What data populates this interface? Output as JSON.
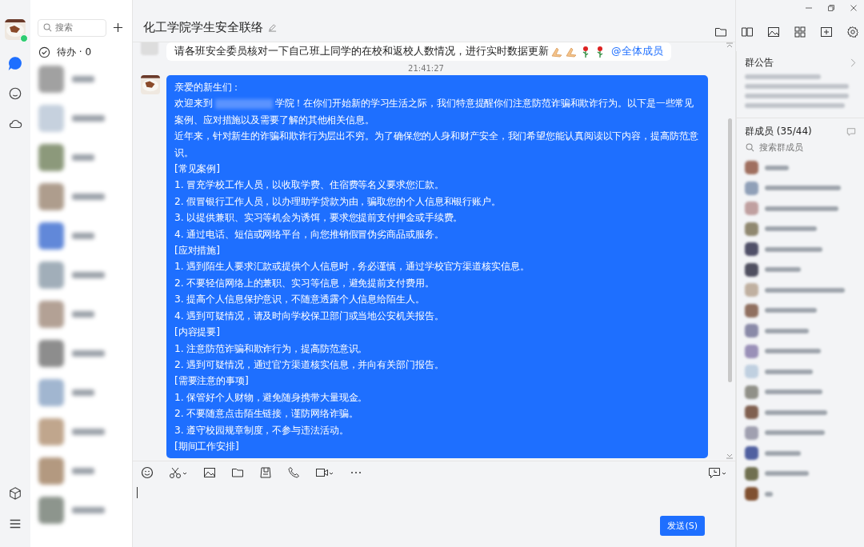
{
  "window": {
    "title": "化工学院学生安全联络"
  },
  "sidebar": {
    "nav": [
      {
        "kind": "chat",
        "selected": true
      },
      {
        "kind": "contacts",
        "selected": false
      },
      {
        "kind": "cloud",
        "selected": false
      }
    ],
    "online": true
  },
  "conversation_list": {
    "search": {
      "placeholder": "搜索"
    },
    "todo": "待办 · 0"
  },
  "chat": {
    "previous_message": {
      "text": "请各班安全委员核对一下自己班上同学的在校和返校人数情况，进行实时数据更新",
      "mention": "@全体成员"
    },
    "time": "21:41:27",
    "message": [
      {
        "kind": "line",
        "text": "亲爱的新生们："
      },
      {
        "kind": "redacted",
        "before": "欢迎来到",
        "after": "学院！在你们开始新的学习生活之际，我们特意提醒你们注意防范诈骗和欺诈行为。以下是一些常见案例、应对措施以及需要了解的其他相关信息。"
      },
      {
        "kind": "line",
        "text": "近年来，针对新生的诈骗和欺诈行为层出不穷。为了确保您的人身和财产安全，我们希望您能认真阅读以下内容，提高防范意识。"
      },
      {
        "kind": "line",
        "text": "[常见案例]"
      },
      {
        "kind": "line",
        "text": "1. 冒充学校工作人员，以收取学费、住宿费等名义要求您汇款。"
      },
      {
        "kind": "line",
        "text": "2. 假冒银行工作人员，以办理助学贷款为由，骗取您的个人信息和银行账户。"
      },
      {
        "kind": "line",
        "text": "3. 以提供兼职、实习等机会为诱饵，要求您提前支付押金或手续费。"
      },
      {
        "kind": "line",
        "text": "4. 通过电话、短信或网络平台，向您推销假冒伪劣商品或服务。"
      },
      {
        "kind": "line",
        "text": "[应对措施]"
      },
      {
        "kind": "line",
        "text": "1. 遇到陌生人要求汇款或提供个人信息时，务必谨慎，通过学校官方渠道核实信息。"
      },
      {
        "kind": "line",
        "text": "2. 不要轻信网络上的兼职、实习等信息，避免提前支付费用。"
      },
      {
        "kind": "line",
        "text": "3. 提高个人信息保护意识，不随意透露个人信息给陌生人。"
      },
      {
        "kind": "line",
        "text": "4. 遇到可疑情况，请及时向学校保卫部门或当地公安机关报告。"
      },
      {
        "kind": "line",
        "text": "[内容提要]"
      },
      {
        "kind": "line",
        "text": "1. 注意防范诈骗和欺诈行为，提高防范意识。"
      },
      {
        "kind": "line",
        "text": "2. 遇到可疑情况，通过官方渠道核实信息，并向有关部门报告。"
      },
      {
        "kind": "line",
        "text": "[需要注意的事项]"
      },
      {
        "kind": "line",
        "text": "1. 保管好个人财物，避免随身携带大量现金。"
      },
      {
        "kind": "line",
        "text": "2. 不要随意点击陌生链接，谨防网络诈骗。"
      },
      {
        "kind": "line",
        "text": "3. 遵守校园规章制度，不参与违法活动。"
      },
      {
        "kind": "line",
        "text": "[期间工作安排]"
      }
    ],
    "send_button": "发送(S)"
  },
  "right_panel": {
    "announcement_title": "群公告",
    "members_title": "群成员 (35/44)",
    "member_search": {
      "placeholder": "搜索群成员"
    }
  }
}
